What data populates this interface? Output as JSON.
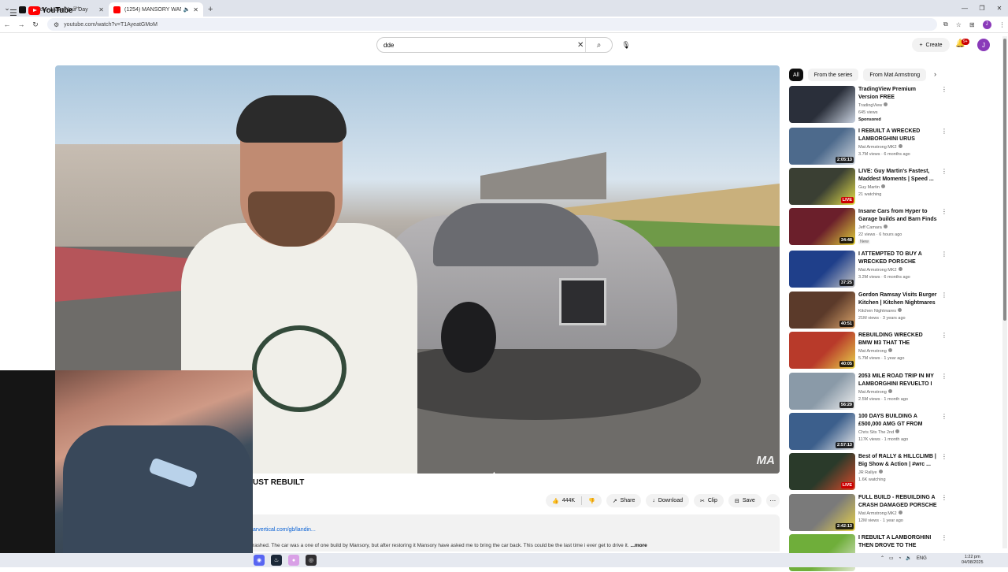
{
  "browser": {
    "tabs": [
      {
        "title": "TikTok - Make Your Day",
        "active": false,
        "color": "#111111"
      },
      {
        "title": "(1254) MANSORY WANT BACK",
        "active": true,
        "color": "#ff0000"
      }
    ],
    "url": "youtube.com/watch?v=T1AyeatGMoM",
    "profile_initial": "J"
  },
  "header": {
    "logo_text": "YouTube",
    "logo_country": "PH",
    "search_value": "dde",
    "create_label": "Create",
    "notif_count": "9+",
    "avatar_initial": "J"
  },
  "video": {
    "watermark": "MA",
    "title": "UST REBUILT",
    "likes": "444K",
    "share_label": "Share",
    "download_label": "Download",
    "clip_label": "Clip",
    "save_label": "Save",
    "desc_link": "arvertical.com/gb/landin...",
    "desc_text": "rashed. The car was a one of one build by Mansory, but after restoring it Mansory have asked me to bring the car back. This could be the last time i ever get to drive it.",
    "desc_more": "...more"
  },
  "sidebar": {
    "chips": [
      "All",
      "From the series",
      "From Mat Armstrong"
    ],
    "items": [
      {
        "title": "TradingView Premium Version FREE",
        "channel": "TradingView",
        "meta": "645 views",
        "extra": "Sponsored",
        "duration": "",
        "thumb": "#2a2f3a",
        "thumb2": "#c9d2e0"
      },
      {
        "title": "I REBUILT A WRECKED LAMBORGHINI URUS",
        "channel": "Mat Armstrong MK2",
        "meta": "3.7M views · 6 months ago",
        "extra": "",
        "duration": "2:05:13",
        "thumb": "#4d6a8c",
        "thumb2": "#d0d7de"
      },
      {
        "title": "LIVE: Guy Martin's Fastest, Maddest Moments | Speed ...",
        "channel": "Guy Martin",
        "meta": "21 watching",
        "extra": "",
        "duration": "LIVE",
        "thumb": "#3a3f33",
        "thumb2": "#e5e04a"
      },
      {
        "title": "Insane Cars from Hyper to Garage builds and Barn Finds",
        "channel": "Jeff Camara",
        "meta": "22 views · 6 hours ago",
        "extra": "New",
        "duration": "34:48",
        "thumb": "#6b1f2b",
        "thumb2": "#e0cf3a"
      },
      {
        "title": "I ATTEMPTED TO BUY A WRECKED PORSCHE CARRER...",
        "channel": "Mat Armstrong MK2",
        "meta": "3.2M views · 6 months ago",
        "extra": "",
        "duration": "37:25",
        "thumb": "#1f3f8a",
        "thumb2": "#c9c9c9"
      },
      {
        "title": "Gordon Ramsay Visits Burger Kitchen | Kitchen Nightmares ...",
        "channel": "Kitchen Nightmares",
        "meta": "21M views · 3 years ago",
        "extra": "",
        "duration": "40:51",
        "thumb": "#5b3a2a",
        "thumb2": "#d9a36a"
      },
      {
        "title": "REBUILDING WRECKED BMW M3 THAT THE INSURANCE ...",
        "channel": "Mat Armstrong",
        "meta": "5.7M views · 1 year ago",
        "extra": "",
        "duration": "40:05",
        "thumb": "#b83a2a",
        "thumb2": "#e8d24a"
      },
      {
        "title": "2053 MILE ROAD TRIP IN MY LAMBORGHINI REVUELTO I ...",
        "channel": "Mat Armstrong",
        "meta": "2.5M views · 1 month ago",
        "extra": "",
        "duration": "56:29",
        "thumb": "#8a9aa8",
        "thumb2": "#f0f0f0"
      },
      {
        "title": "100 DAYS BUILDING A £500,000 AMG GT FROM TEMU",
        "channel": "Chris Sits The 2nd",
        "meta": "117K views · 1 month ago",
        "extra": "",
        "duration": "2:57:13",
        "thumb": "#3c5f8c",
        "thumb2": "#e9e9e9"
      },
      {
        "title": "Best of RALLY & HILLCLIMB | Big Show & Action | #wrc ...",
        "channel": "JR Rallye",
        "meta": "1.6K watching",
        "extra": "",
        "duration": "LIVE",
        "thumb": "#2a3a2a",
        "thumb2": "#d94a2a"
      },
      {
        "title": "FULL BUILD - REBUILDING A CRASH DAMAGED PORSCHE ...",
        "channel": "Mat Armstrong MK2",
        "meta": "12M views · 1 year ago",
        "extra": "",
        "duration": "2:42:13",
        "thumb": "#7a7a7a",
        "thumb2": "#e8d24a"
      },
      {
        "title": "I REBUILT A LAMBORGHINI THEN DROVE TO THE WORLD...",
        "channel": "",
        "meta": "",
        "extra": "",
        "duration": "",
        "thumb": "#6fae3a",
        "thumb2": "#e0e8d0"
      }
    ]
  },
  "taskbar": {
    "lang": "ENG",
    "time": "1:22 pm",
    "date": "04/08/2025"
  }
}
